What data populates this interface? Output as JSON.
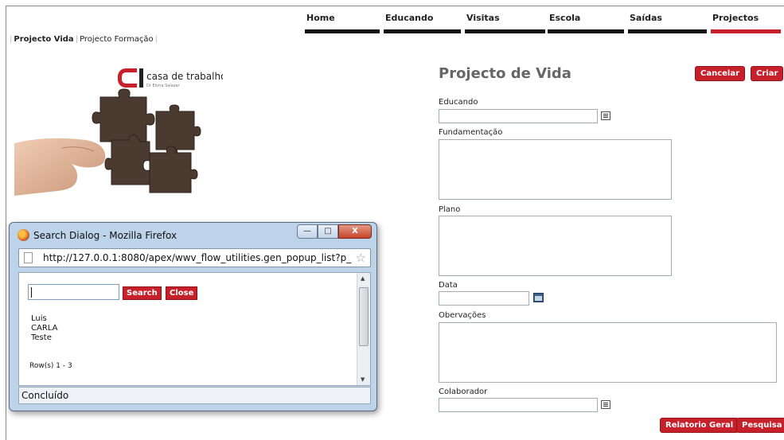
{
  "nav": {
    "items": [
      {
        "label": "Home"
      },
      {
        "label": "Educando"
      },
      {
        "label": "Visitas"
      },
      {
        "label": "Escola"
      },
      {
        "label": "Saídas"
      },
      {
        "label": "Projectos"
      }
    ],
    "active_color": "#c8202a"
  },
  "subtabs": [
    {
      "label": "Projecto Vida"
    },
    {
      "label": "Projecto Formação"
    }
  ],
  "logo": {
    "brand": "casa de trabalho",
    "sub": "Dr Elvira Salazar"
  },
  "form": {
    "title": "Projecto de Vida",
    "cancel_label": "Cancelar",
    "create_label": "Criar",
    "fields": {
      "educando": {
        "label": "Educando",
        "value": ""
      },
      "fundamentacao": {
        "label": "Fundamentação",
        "value": ""
      },
      "plano": {
        "label": "Plano",
        "value": ""
      },
      "data": {
        "label": "Data",
        "value": ""
      },
      "observacoes": {
        "label": "Obervações",
        "value": ""
      },
      "colaborador": {
        "label": "Colaborador",
        "value": ""
      }
    },
    "report_label": "Relatorio Geral",
    "search_label": "Pesquisa"
  },
  "dialog": {
    "title": "Search Dialog - Mozilla Firefox",
    "url": "http://127.0.0.1:8080/apex/wwv_flow_utilities.gen_popup_list?p_",
    "search_value": "",
    "search_button": "Search",
    "close_button": "Close",
    "results": [
      "Luis",
      "CARLA",
      "Teste"
    ],
    "rows_text": "Row(s) 1 - 3",
    "status": "Concluído",
    "win_min": "—",
    "win_max": "□",
    "win_close": "X",
    "star": "☆"
  },
  "colors": {
    "accent": "#c8202a",
    "nav_bar": "#111111"
  }
}
